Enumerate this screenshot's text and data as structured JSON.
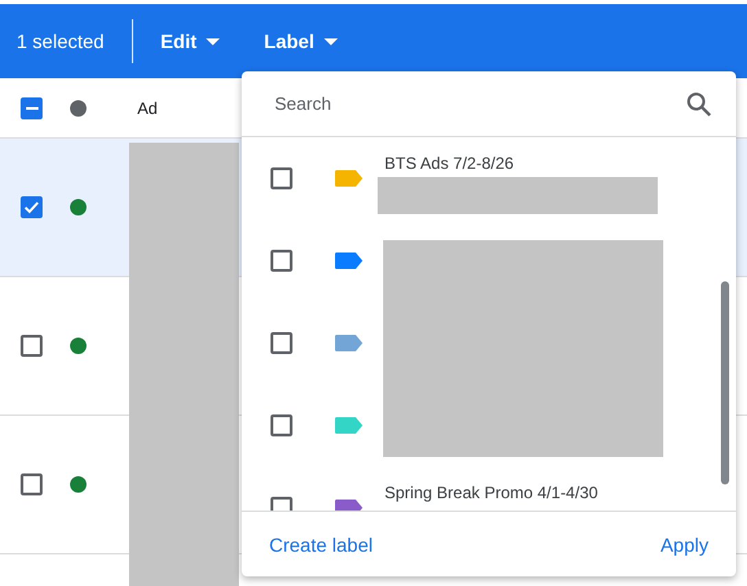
{
  "toolbar": {
    "selection_count": "1 selected",
    "menus": [
      {
        "label": "Edit"
      },
      {
        "label": "Label"
      }
    ]
  },
  "table": {
    "header": {
      "indeterminate": true,
      "column_2": "Ad"
    },
    "rows": [
      {
        "checked": true
      },
      {
        "checked": false
      },
      {
        "checked": false
      }
    ]
  },
  "label_menu": {
    "search": {
      "placeholder": "Search"
    },
    "labels": [
      {
        "name": "BTS Ads 7/2-8/26",
        "checked": false,
        "color": "#f4b400"
      },
      {
        "checked": false,
        "color": "#0a7cff"
      },
      {
        "checked": false,
        "color": "#73a5d6"
      },
      {
        "checked": false,
        "color": "#33d6c6"
      },
      {
        "name": "Spring Break Promo 4/1-4/30",
        "checked": false,
        "color": "#8a5cc9"
      }
    ],
    "create_button": "Create label",
    "apply_button": "Apply"
  }
}
